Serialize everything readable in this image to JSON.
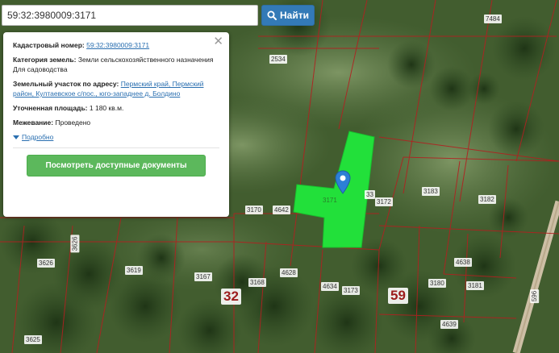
{
  "search": {
    "query": "59:32:3980009:3171",
    "button_label": "Найти"
  },
  "popup": {
    "cadastral_label": "Кадастровый номер:",
    "cadastral_value": "59:32:3980009:3171",
    "category_label": "Категория земель:",
    "category_value": "Земли сельскохозяйственного назначения",
    "usage_value": "Для садоводства",
    "address_label": "Земельный участок по адресу:",
    "address_value": "Пермский край, Пермский район, Култаевское с/пос., юго-западнее д. Болдино",
    "area_label": "Уточненная площадь:",
    "area_value": "1 180 кв.м.",
    "survey_label": "Межевание:",
    "survey_value": "Проведено",
    "more_link": "Подробно",
    "docs_button": "Посмотреть доступные документы",
    "close_icon": "close-icon"
  },
  "map": {
    "selected_plot_label": "3171",
    "highlight_color": "#22e03a",
    "boundary_color": "#b22020",
    "pin_color": "#2c7fd6",
    "plot_labels": [
      "7484",
      "2534",
      "3170",
      "4642",
      "33",
      "3172",
      "3183",
      "3182",
      "3626",
      "3619",
      "3167",
      "3168",
      "4628",
      "4634",
      "3173",
      "3180",
      "3181",
      "4638",
      "4639",
      "3625",
      "596"
    ],
    "quarter_labels": [
      "32",
      "59"
    ]
  }
}
